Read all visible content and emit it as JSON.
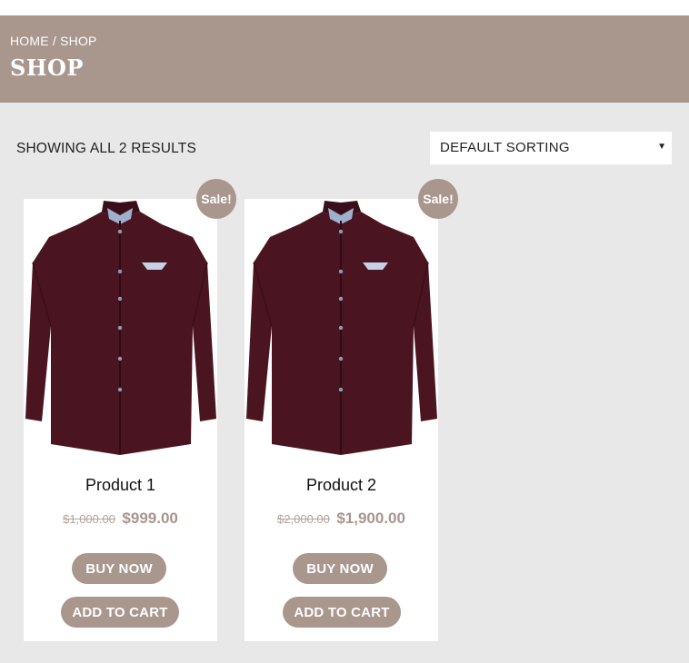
{
  "header": {
    "breadcrumb": {
      "home": "HOME",
      "separator": "/",
      "current": "SHOP"
    },
    "title": "SHOP"
  },
  "toolbar": {
    "results_text": "SHOWING ALL 2 RESULTS",
    "sort_selected": "DEFAULT SORTING"
  },
  "products": [
    {
      "title": "Product 1",
      "sale_badge": "Sale!",
      "old_price": "$1,000.00",
      "new_price": "$999.00",
      "buy_label": "BUY NOW",
      "cart_label": "ADD TO CART"
    },
    {
      "title": "Product 2",
      "sale_badge": "Sale!",
      "old_price": "$2,000.00",
      "new_price": "$1,900.00",
      "buy_label": "BUY NOW",
      "cart_label": "ADD TO CART"
    }
  ],
  "colors": {
    "accent": "#a9968d",
    "background": "#e8e8e8",
    "shirt": "#4a1420"
  }
}
